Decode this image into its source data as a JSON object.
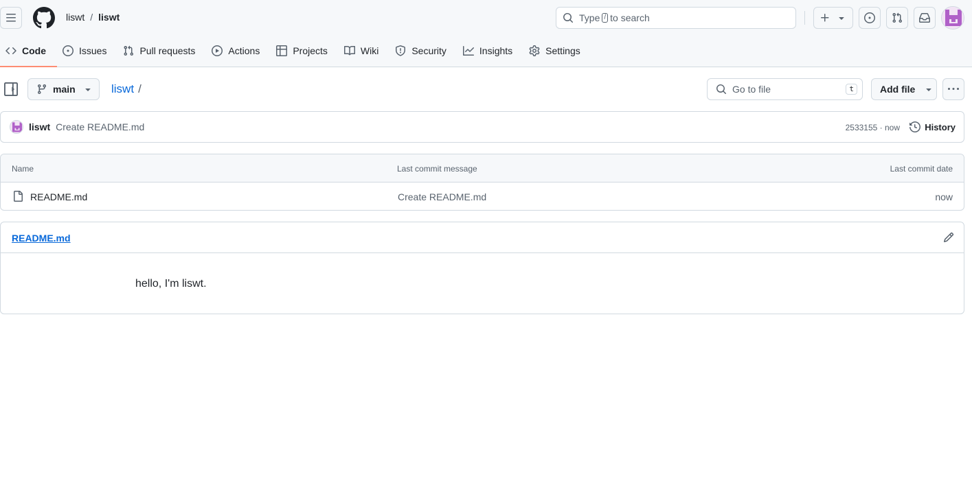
{
  "header": {
    "owner": "liswt",
    "separator": "/",
    "repo": "liswt",
    "search": {
      "prefix": "Type",
      "key": "/",
      "suffix": "to search"
    }
  },
  "tabs": [
    {
      "label": "Code",
      "icon": "code-icon",
      "active": true
    },
    {
      "label": "Issues",
      "icon": "issue-opened-icon",
      "active": false
    },
    {
      "label": "Pull requests",
      "icon": "git-pull-request-icon",
      "active": false
    },
    {
      "label": "Actions",
      "icon": "play-icon",
      "active": false
    },
    {
      "label": "Projects",
      "icon": "table-icon",
      "active": false
    },
    {
      "label": "Wiki",
      "icon": "book-icon",
      "active": false
    },
    {
      "label": "Security",
      "icon": "shield-icon",
      "active": false
    },
    {
      "label": "Insights",
      "icon": "graph-icon",
      "active": false
    },
    {
      "label": "Settings",
      "icon": "gear-icon",
      "active": false
    }
  ],
  "filenav": {
    "branch": "main",
    "path_root": "liswt",
    "path_sep": "/",
    "goto_placeholder": "Go to file",
    "goto_shortcut": "t",
    "add_file": "Add file"
  },
  "commit": {
    "author": "liswt",
    "message": "Create README.md",
    "meta": "2533155 · now",
    "history": "History"
  },
  "files": {
    "headers": {
      "name": "Name",
      "message": "Last commit message",
      "date": "Last commit date"
    },
    "rows": [
      {
        "name": "README.md",
        "message": "Create README.md",
        "date": "now"
      }
    ]
  },
  "readme": {
    "title": "README.md",
    "content": "hello, I'm liswt."
  },
  "colors": {
    "accent_link": "#0969da",
    "active_tab_underline": "#fd8c73",
    "avatar_purple": "#b060c8"
  }
}
